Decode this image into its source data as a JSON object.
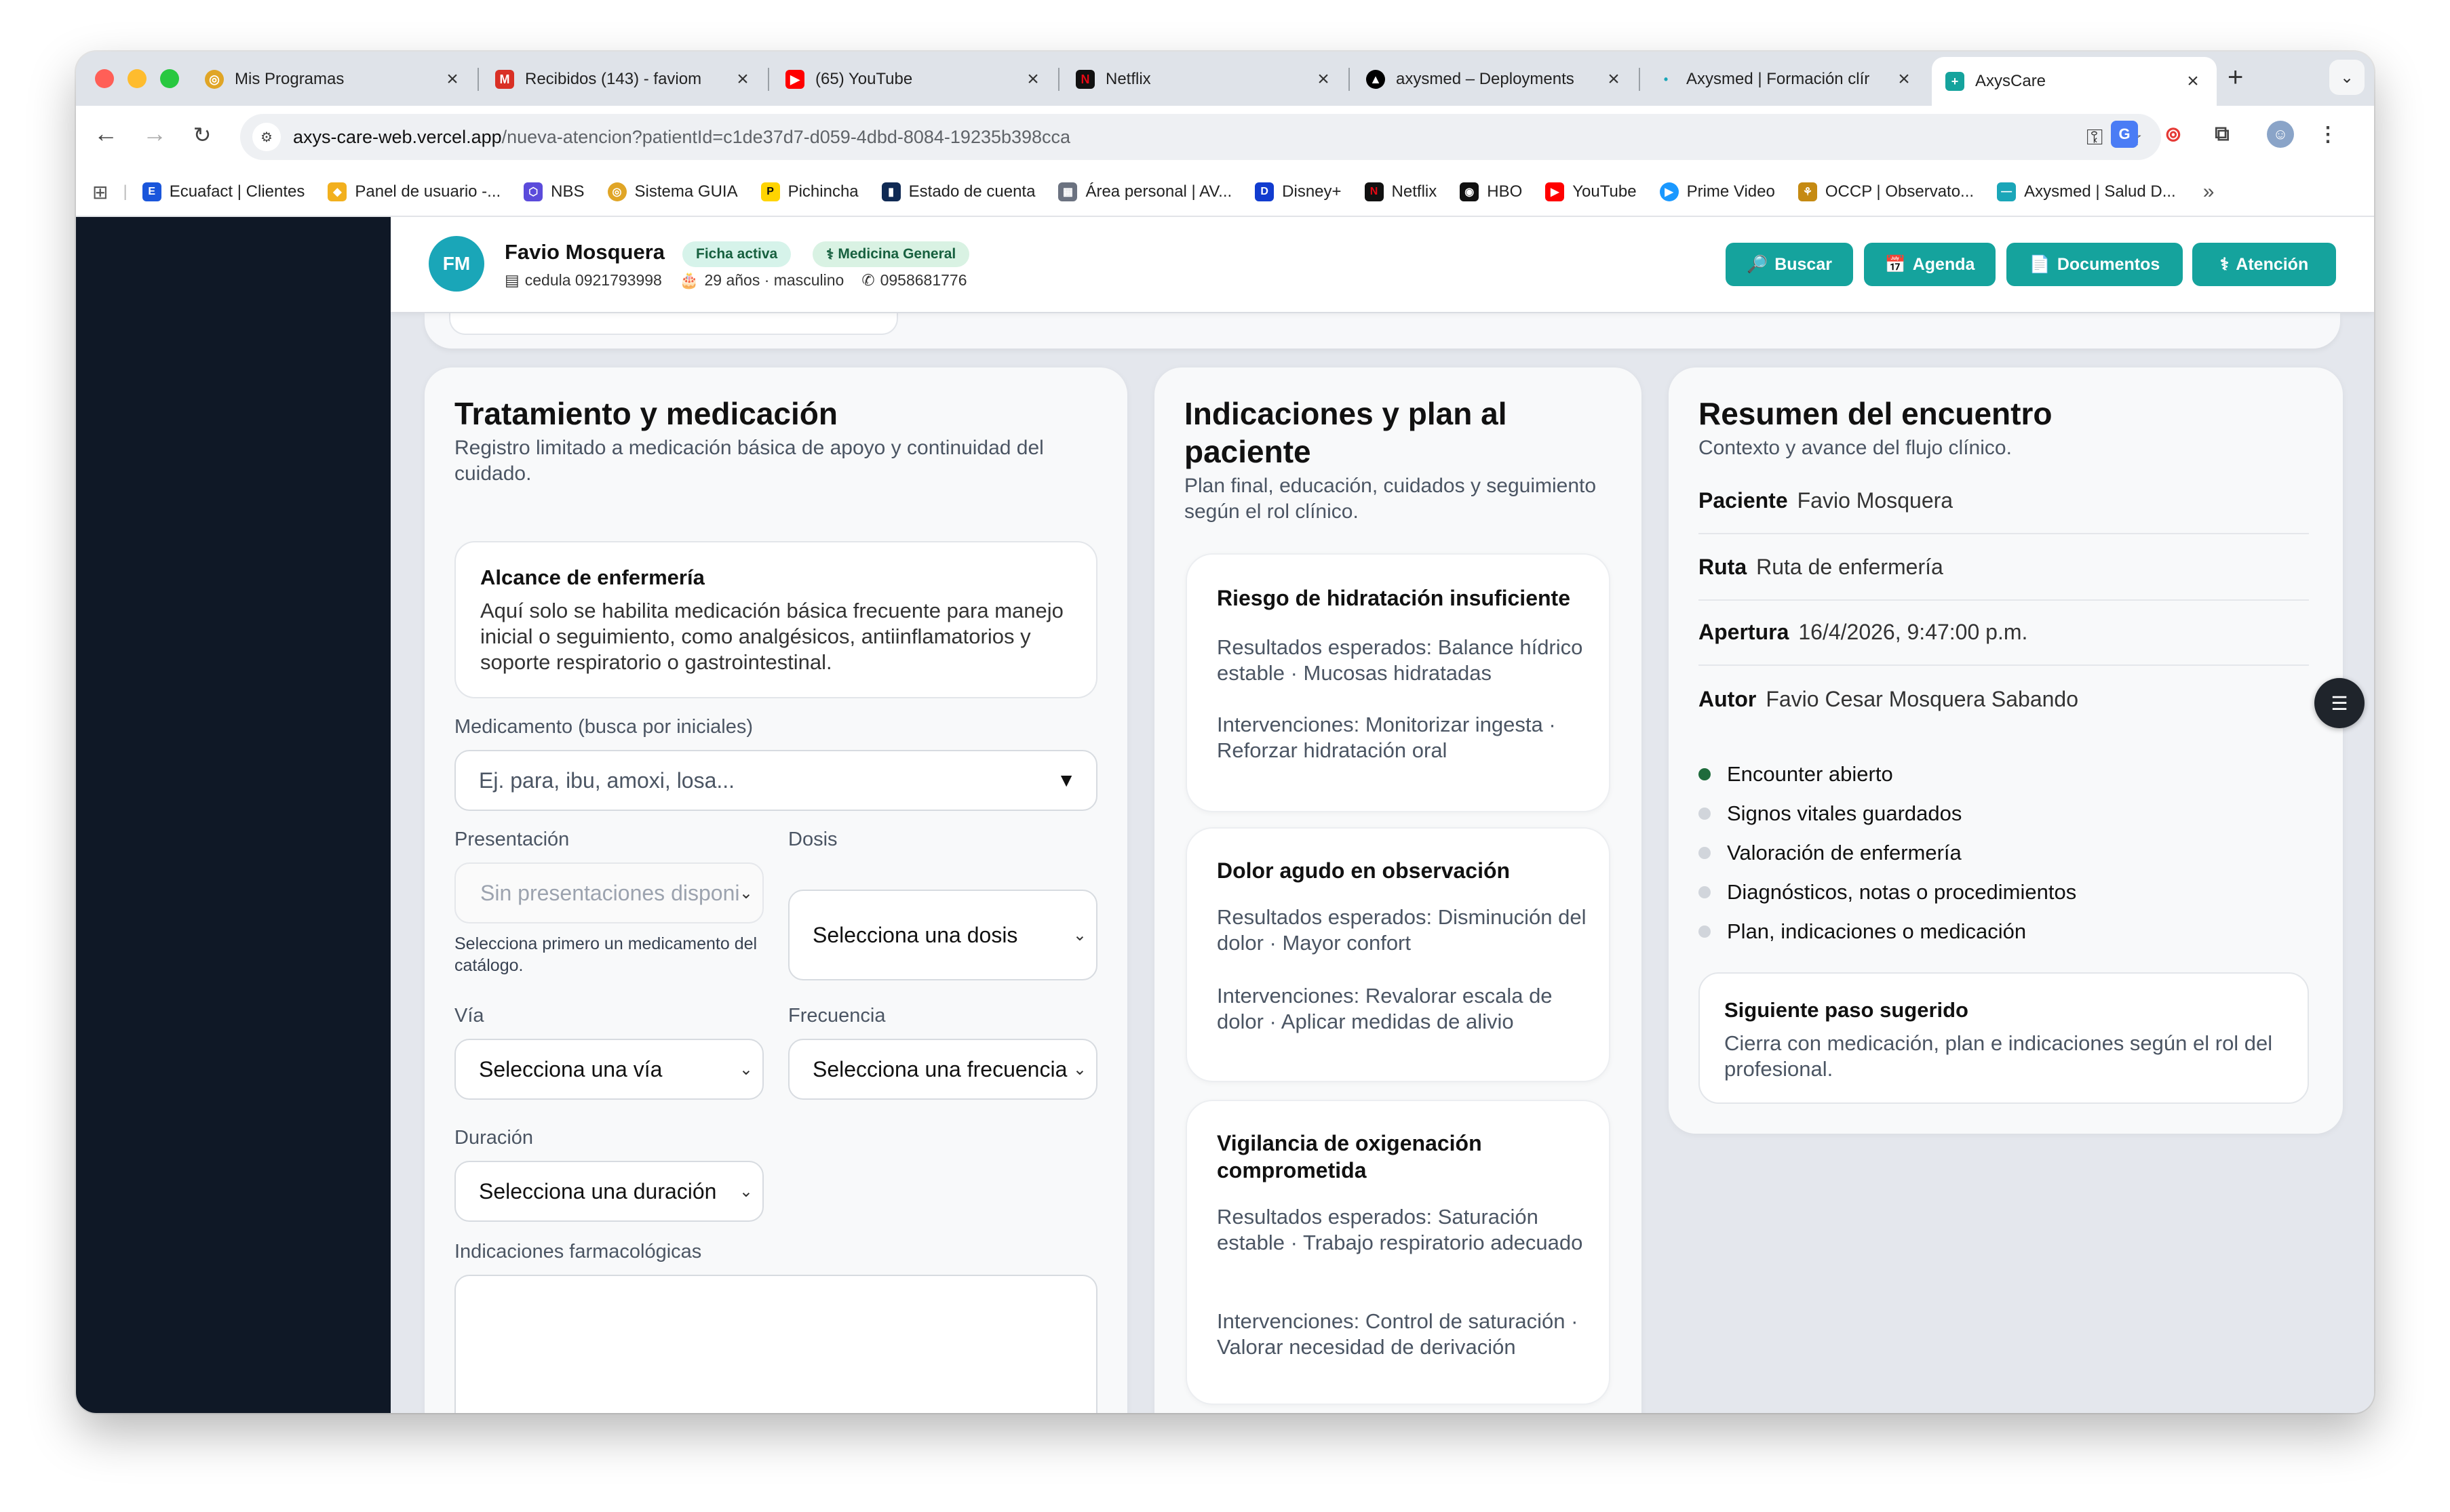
{
  "browser": {
    "tabs": [
      {
        "title": "Mis Programas",
        "icon": "program-icon",
        "color": "#e0a526"
      },
      {
        "title": "Recibidos (143) - faviom",
        "icon": "gmail-icon",
        "color": "#d93025"
      },
      {
        "title": "(65) YouTube",
        "icon": "youtube-icon",
        "color": "#ff0000"
      },
      {
        "title": "Netflix",
        "icon": "netflix-icon",
        "color": "#e50914"
      },
      {
        "title": "axysmed – Deployments",
        "icon": "vercel-icon",
        "color": "#000000"
      },
      {
        "title": "Axysmed | Formación clír",
        "icon": "dot-icon",
        "color": "#1aa6b8"
      },
      {
        "title": "AxysCare",
        "icon": "axyscare-icon",
        "color": "#15a39d"
      }
    ],
    "url_host": "axys-care-web.vercel.app",
    "url_path": "/nueva-atencion?patientId=c1de37d7-d059-4dbd-8084-19235b398cca",
    "bookmarks": [
      {
        "label": "Ecuafact | Clientes",
        "color": "#1a56db"
      },
      {
        "label": "Panel de usuario -...",
        "color": "#f2b01e"
      },
      {
        "label": "NBS",
        "color": "#5b4bdb"
      },
      {
        "label": "Sistema GUIA",
        "color": "#e0a526"
      },
      {
        "label": "Pichincha",
        "color": "#ffd400"
      },
      {
        "label": "Estado de cuenta",
        "color": "#102a54"
      },
      {
        "label": "Área personal | AV...",
        "color": "#6b7280"
      },
      {
        "label": "Disney+",
        "color": "#113ccf"
      },
      {
        "label": "Netflix",
        "color": "#e50914"
      },
      {
        "label": "HBO",
        "color": "#111111"
      },
      {
        "label": "YouTube",
        "color": "#ff0000"
      },
      {
        "label": "Prime Video",
        "color": "#1a98ff"
      },
      {
        "label": "OCCP | Observato...",
        "color": "#c58a12"
      },
      {
        "label": "Axysmed | Salud D...",
        "color": "#1aa6b8"
      }
    ]
  },
  "header": {
    "initials": "FM",
    "patient_name": "Favio Mosquera",
    "status_badge": "Ficha activa",
    "specialty_badge": "Medicina General",
    "cedula": "cedula 0921793998",
    "age_sex": "29 años · masculino",
    "phone": "0958681776",
    "buttons": {
      "search": "Buscar",
      "agenda": "Agenda",
      "documents": "Documentos",
      "attention": "Atención"
    }
  },
  "treatment": {
    "title": "Tratamiento y medicación",
    "subtitle": "Registro limitado a medicación básica de apoyo y continuidad del cuidado.",
    "scope_title": "Alcance de enfermería",
    "scope_text": "Aquí solo se habilita medicación básica frecuente para manejo inicial o seguimiento, como analgésicos, antiinflamatorios y soporte respiratorio o gastrointestinal.",
    "medication_label": "Medicamento (busca por iniciales)",
    "medication_placeholder": "Ej. para, ibu, amoxi, losa...",
    "presentation_label": "Presentación",
    "presentation_value": "Sin presentaciones disponi",
    "presentation_hint": "Selecciona primero un medicamento del catálogo.",
    "dose_label": "Dosis",
    "dose_value": "Selecciona una dosis",
    "route_label": "Vía",
    "route_value": "Selecciona una vía",
    "frequency_label": "Frecuencia",
    "frequency_value": "Selecciona una frecuencia",
    "duration_label": "Duración",
    "duration_value": "Selecciona una duración",
    "indications_label": "Indicaciones farmacológicas"
  },
  "plan": {
    "title": "Indicaciones y plan al paciente",
    "subtitle": "Plan final, educación, cuidados y seguimiento según el rol clínico.",
    "items": [
      {
        "title": "Riesgo de hidratación insuficiente",
        "expected": "Resultados esperados: Balance hídrico estable · Mucosas hidratadas",
        "interventions": "Intervenciones: Monitorizar ingesta · Reforzar hidratación oral"
      },
      {
        "title": "Dolor agudo en observación",
        "expected": "Resultados esperados: Disminución del dolor · Mayor confort",
        "interventions": "Intervenciones: Revalorar escala de dolor · Aplicar medidas de alivio"
      },
      {
        "title": "Vigilancia de oxigenación comprometida",
        "expected": "Resultados esperados: Saturación estable · Trabajo respiratorio adecuado",
        "interventions": "Intervenciones: Control de saturación · Valorar necesidad de derivación"
      }
    ]
  },
  "summary": {
    "title": "Resumen del encuentro",
    "subtitle": "Contexto y avance del flujo clínico.",
    "rows": [
      {
        "label": "Paciente",
        "value": "Favio Mosquera"
      },
      {
        "label": "Ruta",
        "value": "Ruta de enfermería"
      },
      {
        "label": "Apertura",
        "value": "16/4/2026, 9:47:00 p.m."
      },
      {
        "label": "Autor",
        "value": "Favio Cesar Mosquera Sabando"
      }
    ],
    "steps": [
      {
        "label": "Encounter abierto",
        "done": true
      },
      {
        "label": "Signos vitales guardados",
        "done": false
      },
      {
        "label": "Valoración de enfermería",
        "done": false
      },
      {
        "label": "Diagnósticos, notas o procedimientos",
        "done": false
      },
      {
        "label": "Plan, indicaciones o medicación",
        "done": false
      }
    ],
    "next_title": "Siguiente paso sugerido",
    "next_text": "Cierra con medicación, plan e indicaciones según el rol del profesional."
  },
  "colors": {
    "accent": "#15a39d",
    "sidebar": "#0f1826",
    "avatar": "#1aa6b8",
    "done": "#1f6b3c"
  }
}
